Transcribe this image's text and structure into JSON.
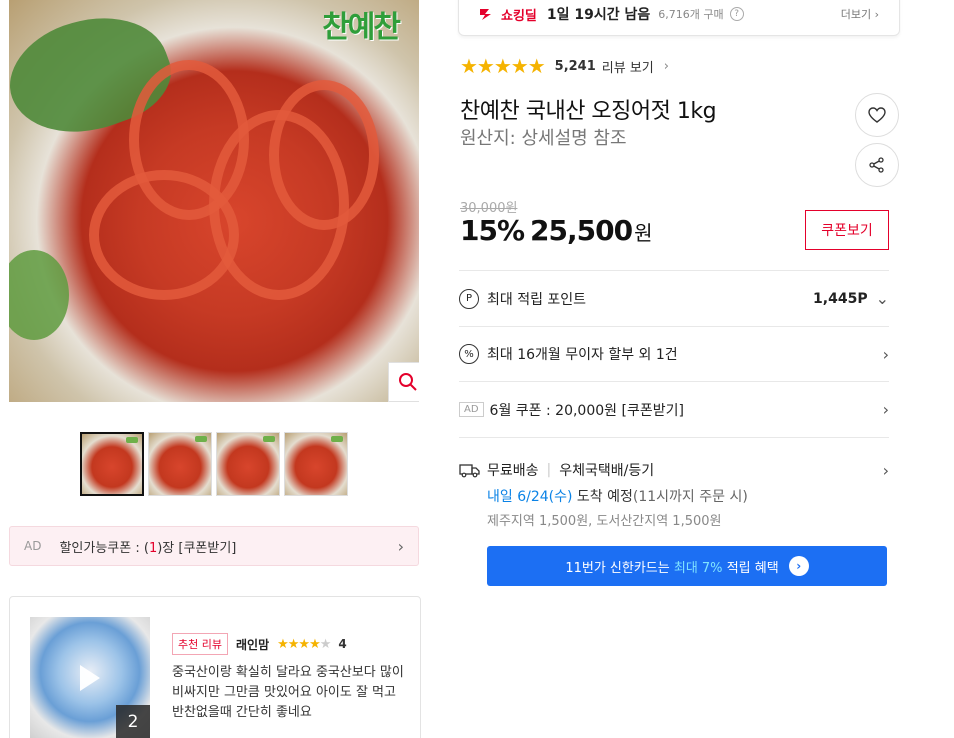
{
  "product": {
    "brand_logo": "찬예찬",
    "title": "찬예찬 국내산 오징어젓 1kg",
    "origin": "원산지: 상세설명 참조",
    "rating_stars": "★★★★★",
    "review_count": "5,241",
    "review_link": "리뷰 보기"
  },
  "deal": {
    "label": "쇼킹딜",
    "remaining": "1일 19시간 남음",
    "buyers": "6,716개 구매",
    "more": "더보기"
  },
  "price": {
    "original": "30,000원",
    "discount": "15%",
    "sale": "25,500",
    "unit": "원",
    "coupon_button": "쿠폰보기"
  },
  "benefits": {
    "points_label": "최대 적립 포인트",
    "points_value": "1,445P",
    "installment": "최대 16개월 무이자 할부 외 1건",
    "ad_tag": "AD",
    "coupon_june": "6월 쿠폰 : 20,000원 [쿠폰받기]"
  },
  "shipping": {
    "free": "무료배송",
    "carrier": "우체국택배/등기",
    "arrival_date": "내일 6/24(수)",
    "arrival_text": "도착 예정",
    "arrival_note": "(11시까지 주문 시)",
    "extra_fee": "제주지역 1,500원, 도서산간지역 1,500원"
  },
  "card_banner": {
    "prefix": "11번가 신한카드는",
    "highlight": "최대 7%",
    "suffix": "적립 혜택"
  },
  "ad_coupon": {
    "tag": "AD",
    "text_prefix": "할인가능쿠폰 : (",
    "count": "1",
    "text_suffix": ")장 [쿠폰받기]"
  },
  "review": {
    "badge": "추천 리뷰",
    "reviewer": "래인맘",
    "stars_on": "★★★★",
    "stars_off": "★",
    "score": "4",
    "text": "중국산이랑 확실히 달라요 중국산보다 많이 비싸지만 그만큼 맛있어요 아이도 잘 먹고 반찬없을때 간단히 좋네요",
    "media_count": "2"
  },
  "colors": {
    "accent": "#e4002b",
    "blue": "#0b83e6",
    "banner": "#1c6ff3",
    "star": "#f5b301"
  }
}
